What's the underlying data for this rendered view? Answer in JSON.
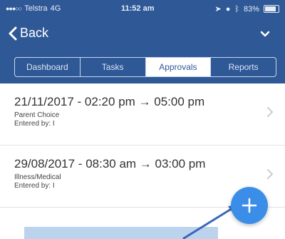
{
  "status_bar": {
    "carrier": "Telstra",
    "network": "4G",
    "time": "11:52 am",
    "battery": "83%",
    "battery_level": 0.83
  },
  "nav": {
    "back_label": "Back"
  },
  "tabs": [
    {
      "label": "Dashboard",
      "active": false
    },
    {
      "label": "Tasks",
      "active": false
    },
    {
      "label": "Approvals",
      "active": true
    },
    {
      "label": "Reports",
      "active": false
    }
  ],
  "entries": [
    {
      "title": "21/11/2017 - 02:20 pm → 05:00 pm",
      "reason": "Parent Choice",
      "entered_by": "Entered by: I"
    },
    {
      "title": "29/08/2017 - 08:30 am → 03:00 pm",
      "reason": "Illness/Medical",
      "entered_by": "Entered by: I"
    }
  ],
  "colors": {
    "header": "#2f5896",
    "fab": "#3b8ee8",
    "annotation": "#3a68b8"
  },
  "icons": {
    "back": "chevron-left-icon",
    "menu": "chevron-down-icon",
    "row": "chevron-right-icon",
    "fab": "plus-icon"
  }
}
